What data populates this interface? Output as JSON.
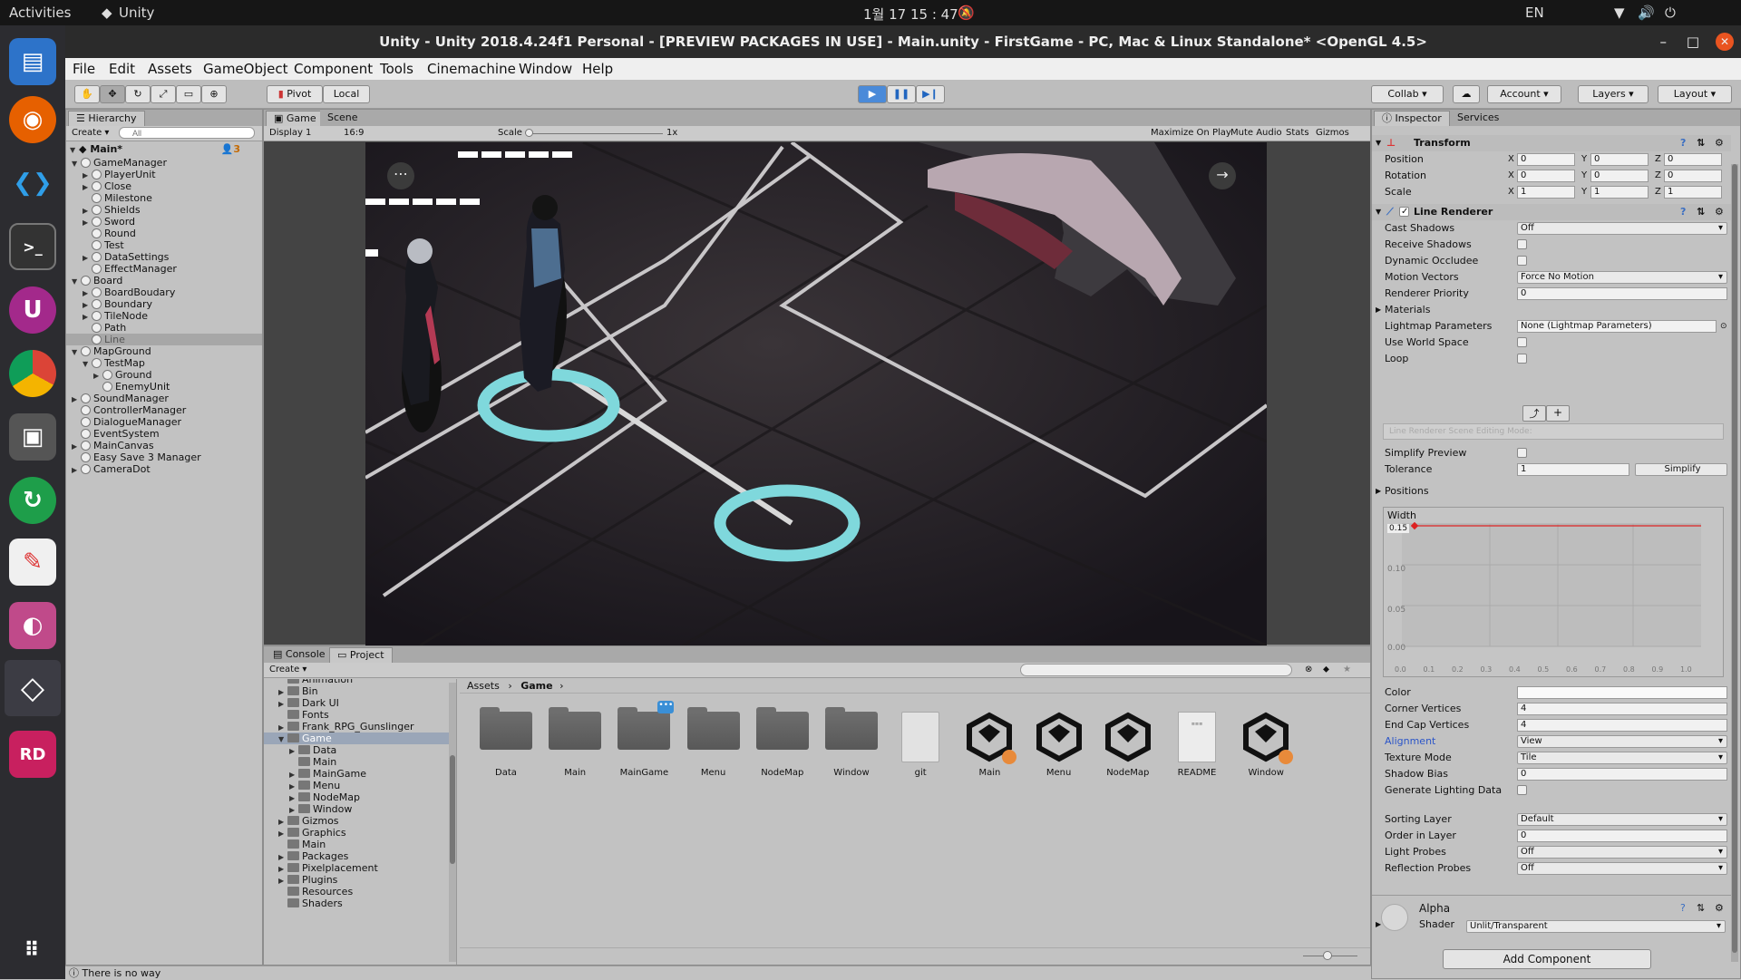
{
  "os": {
    "activities": "Activities",
    "app_name": "Unity",
    "clock": "1월 17  15 : 47",
    "lang": "EN"
  },
  "window": {
    "title": "Unity - Unity 2018.4.24f1 Personal - [PREVIEW PACKAGES IN USE] - Main.unity - FirstGame - PC, Mac & Linux Standalone* <OpenGL 4.5>"
  },
  "menu": [
    "File",
    "Edit",
    "Assets",
    "GameObject",
    "Component",
    "Tools",
    "Cinemachine",
    "Window",
    "Help"
  ],
  "toolbar": {
    "pivot": "Pivot",
    "local": "Local",
    "collab": "Collab",
    "account": "Account",
    "layers": "Layers",
    "layout": "Layout"
  },
  "hierarchy": {
    "tab": "Hierarchy",
    "create": "Create",
    "search_placeholder": "All",
    "scene": "Main*",
    "count": "3",
    "items": [
      {
        "label": "GameManager",
        "depth": 0,
        "arrow": "down"
      },
      {
        "label": "PlayerUnit",
        "depth": 1,
        "arrow": "right"
      },
      {
        "label": "Close",
        "depth": 1,
        "arrow": "right"
      },
      {
        "label": "Milestone",
        "depth": 1,
        "arrow": ""
      },
      {
        "label": "Shields",
        "depth": 1,
        "arrow": "right"
      },
      {
        "label": "Sword",
        "depth": 1,
        "arrow": "right"
      },
      {
        "label": "Round",
        "depth": 1,
        "arrow": ""
      },
      {
        "label": "Test",
        "depth": 1,
        "arrow": ""
      },
      {
        "label": "DataSettings",
        "depth": 1,
        "arrow": "right"
      },
      {
        "label": "EffectManager",
        "depth": 1,
        "arrow": ""
      },
      {
        "label": "Board",
        "depth": 0,
        "arrow": "down"
      },
      {
        "label": "BoardBoudary",
        "depth": 1,
        "arrow": "right"
      },
      {
        "label": "Boundary",
        "depth": 1,
        "arrow": "right"
      },
      {
        "label": "TileNode",
        "depth": 1,
        "arrow": "right"
      },
      {
        "label": "Path",
        "depth": 1,
        "arrow": ""
      },
      {
        "label": "Line",
        "depth": 1,
        "arrow": "",
        "selected": true
      },
      {
        "label": "MapGround",
        "depth": 0,
        "arrow": "down"
      },
      {
        "label": "TestMap",
        "depth": 1,
        "arrow": "down"
      },
      {
        "label": "Ground",
        "depth": 2,
        "arrow": "right"
      },
      {
        "label": "EnemyUnit",
        "depth": 2,
        "arrow": ""
      },
      {
        "label": "SoundManager",
        "depth": 0,
        "arrow": "right"
      },
      {
        "label": "ControllerManager",
        "depth": 0,
        "arrow": ""
      },
      {
        "label": "DialogueManager",
        "depth": 0,
        "arrow": ""
      },
      {
        "label": "EventSystem",
        "depth": 0,
        "arrow": ""
      },
      {
        "label": "MainCanvas",
        "depth": 0,
        "arrow": "right"
      },
      {
        "label": "Easy Save 3 Manager",
        "depth": 0,
        "arrow": ""
      },
      {
        "label": "CameraDot",
        "depth": 0,
        "arrow": "right"
      }
    ]
  },
  "game_view": {
    "tab_game": "Game",
    "tab_scene": "Scene",
    "display": "Display 1",
    "aspect": "16:9",
    "scale_label": "Scale",
    "scale_value": "1x",
    "maximize": "Maximize On Play",
    "mute": "Mute Audio",
    "stats": "Stats",
    "gizmos": "Gizmos"
  },
  "project": {
    "tab_console": "Console",
    "tab_project": "Project",
    "create": "Create",
    "tree": [
      {
        "label": "Animation",
        "depth": 1,
        "arrow": ""
      },
      {
        "label": "Bin",
        "depth": 1,
        "arrow": "right"
      },
      {
        "label": "Dark UI",
        "depth": 1,
        "arrow": "right"
      },
      {
        "label": "Fonts",
        "depth": 1,
        "arrow": ""
      },
      {
        "label": "Frank_RPG_Gunslinger",
        "depth": 1,
        "arrow": "right"
      },
      {
        "label": "Game",
        "depth": 1,
        "arrow": "down",
        "selected": true
      },
      {
        "label": "Data",
        "depth": 2,
        "arrow": "right"
      },
      {
        "label": "Main",
        "depth": 2,
        "arrow": ""
      },
      {
        "label": "MainGame",
        "depth": 2,
        "arrow": "right"
      },
      {
        "label": "Menu",
        "depth": 2,
        "arrow": "right"
      },
      {
        "label": "NodeMap",
        "depth": 2,
        "arrow": "right"
      },
      {
        "label": "Window",
        "depth": 2,
        "arrow": "right"
      },
      {
        "label": "Gizmos",
        "depth": 1,
        "arrow": "right"
      },
      {
        "label": "Graphics",
        "depth": 1,
        "arrow": "right"
      },
      {
        "label": "Main",
        "depth": 1,
        "arrow": ""
      },
      {
        "label": "Packages",
        "depth": 1,
        "arrow": "right"
      },
      {
        "label": "Pixelplacement",
        "depth": 1,
        "arrow": "right"
      },
      {
        "label": "Plugins",
        "depth": 1,
        "arrow": "right"
      },
      {
        "label": "Resources",
        "depth": 1,
        "arrow": ""
      },
      {
        "label": "Shaders",
        "depth": 1,
        "arrow": ""
      }
    ],
    "breadcrumb": [
      "Assets",
      "Game"
    ],
    "assets": [
      {
        "label": "Data",
        "kind": "folder"
      },
      {
        "label": "Main",
        "kind": "folder"
      },
      {
        "label": "MainGame",
        "kind": "folder"
      },
      {
        "label": "Menu",
        "kind": "folder"
      },
      {
        "label": "NodeMap",
        "kind": "folder"
      },
      {
        "label": "Window",
        "kind": "folder"
      },
      {
        "label": "git",
        "kind": "file"
      },
      {
        "label": "Main",
        "kind": "unity"
      },
      {
        "label": "Menu",
        "kind": "unity"
      },
      {
        "label": "NodeMap",
        "kind": "unity"
      },
      {
        "label": "README",
        "kind": "doc"
      },
      {
        "label": "Window",
        "kind": "unity"
      }
    ]
  },
  "status": {
    "message": "There is no way"
  },
  "inspector": {
    "tab_inspector": "Inspector",
    "tab_services": "Services",
    "transform": {
      "title": "Transform",
      "position": {
        "label": "Position",
        "x": "0",
        "y": "0",
        "z": "0"
      },
      "rotation": {
        "label": "Rotation",
        "x": "0",
        "y": "0",
        "z": "0"
      },
      "scale": {
        "label": "Scale",
        "x": "1",
        "y": "1",
        "z": "1"
      }
    },
    "line_renderer": {
      "title": "Line Renderer",
      "cast_shadows": {
        "label": "Cast Shadows",
        "value": "Off"
      },
      "receive_shadows": "Receive Shadows",
      "dynamic_occludee": "Dynamic Occludee",
      "motion_vectors": {
        "label": "Motion Vectors",
        "value": "Force No Motion"
      },
      "renderer_priority": {
        "label": "Renderer Priority",
        "value": "0"
      },
      "materials": "Materials",
      "lightmap": {
        "label": "Lightmap Parameters",
        "value": "None (Lightmap Parameters)"
      },
      "use_world_space": "Use World Space",
      "loop": "Loop",
      "edit_mode_placeholder": "Line Renderer Scene Editing Mode:",
      "simplify_preview": "Simplify Preview",
      "tolerance": {
        "label": "Tolerance",
        "value": "1"
      },
      "simplify_button": "Simplify",
      "positions": "Positions",
      "width_label": "Width",
      "width_value": "0.15",
      "width_yticks": [
        "0.10",
        "0.05",
        "0.00"
      ],
      "width_xticks": [
        "0.0",
        "0.1",
        "0.2",
        "0.3",
        "0.4",
        "0.5",
        "0.6",
        "0.7",
        "0.8",
        "0.9",
        "1.0"
      ],
      "color": "Color",
      "corner_vertices": {
        "label": "Corner Vertices",
        "value": "4"
      },
      "end_cap_vertices": {
        "label": "End Cap Vertices",
        "value": "4"
      },
      "alignment": {
        "label": "Alignment",
        "value": "View"
      },
      "texture_mode": {
        "label": "Texture Mode",
        "value": "Tile"
      },
      "shadow_bias": {
        "label": "Shadow Bias",
        "value": "0"
      },
      "generate_lighting": "Generate Lighting Data",
      "sorting_layer": {
        "label": "Sorting Layer",
        "value": "Default"
      },
      "order_in_layer": {
        "label": "Order in Layer",
        "value": "0"
      },
      "light_probes": {
        "label": "Light Probes",
        "value": "Off"
      },
      "reflection_probes": {
        "label": "Reflection Probes",
        "value": "Off"
      }
    },
    "material": {
      "name": "Alpha",
      "shader_label": "Shader",
      "shader_value": "Unlit/Transparent"
    },
    "add_component": "Add Component"
  }
}
